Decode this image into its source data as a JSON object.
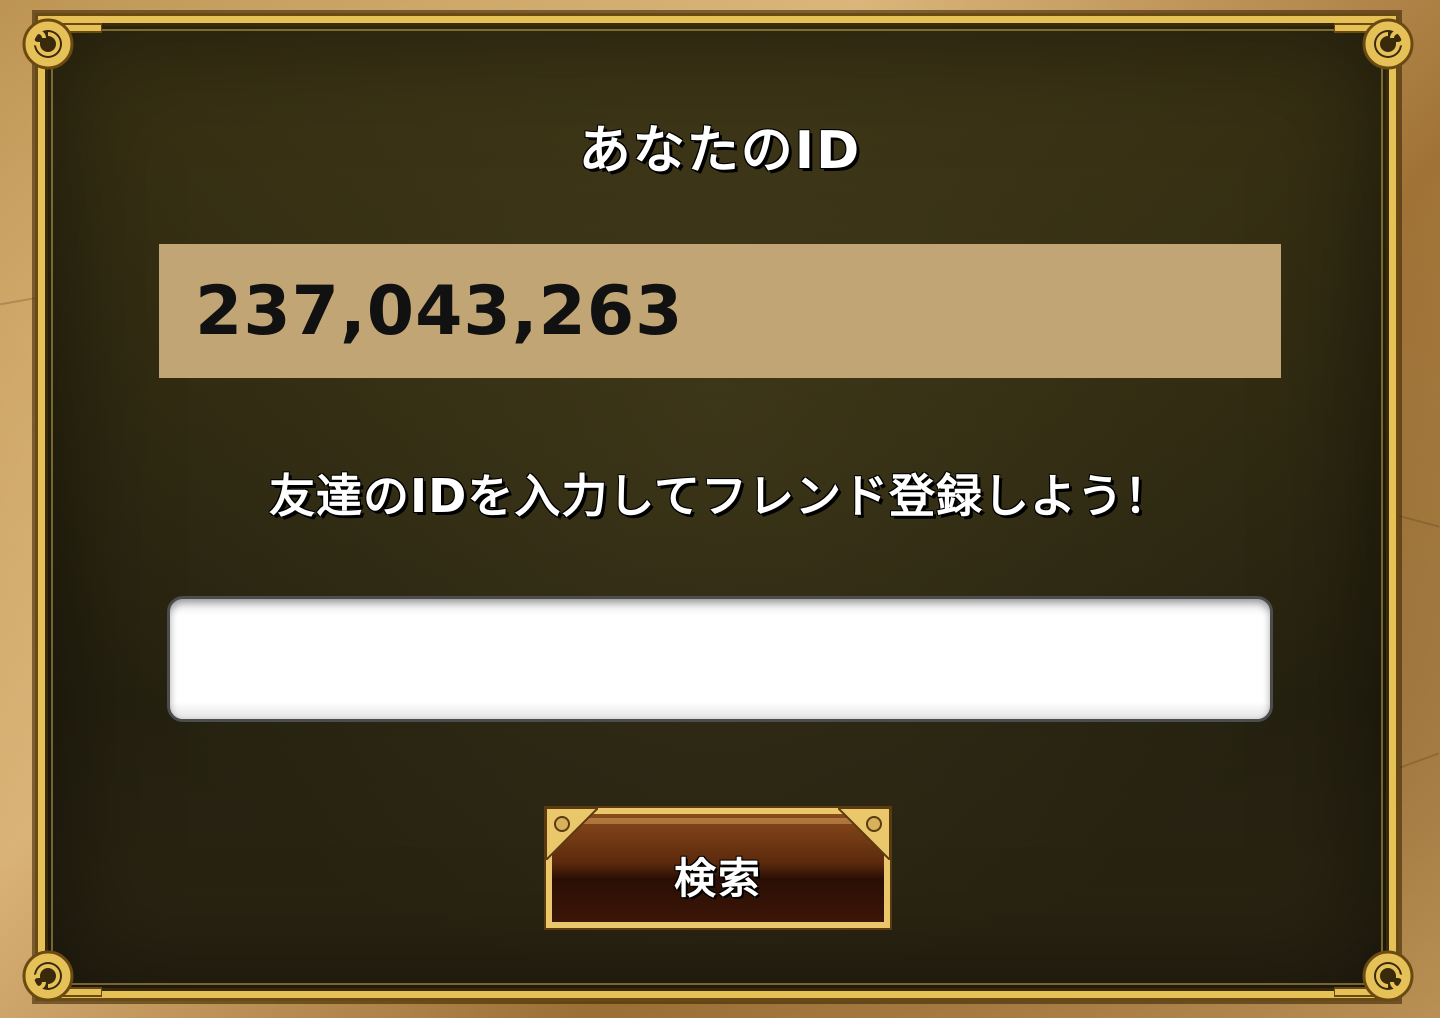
{
  "dialog": {
    "title": "あなたのID",
    "user_id": "237,043,263",
    "prompt": "友達のIDを入力してフレンド登録しよう！",
    "friend_id_input": {
      "value": "",
      "placeholder": ""
    },
    "search_button_label": "検索"
  },
  "colors": {
    "frame_gold": "#e6c158",
    "panel_dark": "#2d2810",
    "id_box_bg": "#c1a574",
    "button_brown": "#5c2a0c",
    "parchment": "#c89d5e"
  },
  "icons": {
    "frame_corners": "ornate-scroll-corner-icon",
    "button_corners": "rivet-corner-icon"
  }
}
